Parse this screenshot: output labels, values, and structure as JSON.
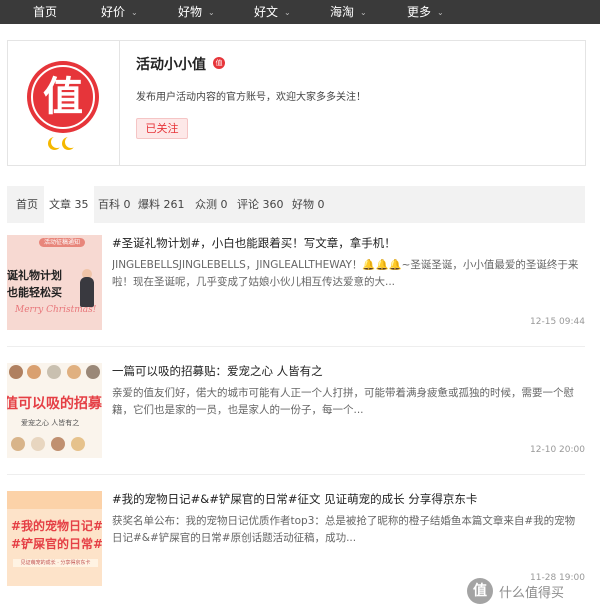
{
  "nav": {
    "items": [
      {
        "label": "首页",
        "dropdown": false
      },
      {
        "label": "好价",
        "dropdown": true
      },
      {
        "label": "好物",
        "dropdown": true
      },
      {
        "label": "好文",
        "dropdown": true
      },
      {
        "label": "海淘",
        "dropdown": true
      },
      {
        "label": "更多",
        "dropdown": true
      }
    ],
    "caret": "⌄"
  },
  "profile": {
    "avatar_glyph": "值",
    "name": "活动小小值",
    "badge": "值",
    "description": "发布用户活动内容的官方账号，欢迎大家多多关注！",
    "follow_label": "已关注"
  },
  "tabs": [
    {
      "label": "首页",
      "count": ""
    },
    {
      "label": "文章",
      "count": "35"
    },
    {
      "label": "百科",
      "count": "0"
    },
    {
      "label": "爆料",
      "count": "261"
    },
    {
      "label": "众测",
      "count": "0"
    },
    {
      "label": "评论",
      "count": "360"
    },
    {
      "label": "好物",
      "count": "0"
    }
  ],
  "active_tab": "文章",
  "articles": [
    {
      "title": "#圣诞礼物计划#，小白也能跟着买！写文章，拿手机！",
      "summary": "JINGLEBELLSJINGLEBELLS，JINGLEALLTHEWAY！🔔🔔🔔~圣诞圣诞，小小值最爱的圣诞终于来啦！现在圣诞呢，几乎变成了姑娘小伙儿相互传达爱意的大...",
      "time": "12-15 09:44",
      "thumb": {
        "tag": "活动征稿通知",
        "line1": "诞礼物计划",
        "line2": "也能轻松买",
        "merry": "Merry Christmas!"
      }
    },
    {
      "title": "一篇可以吸的招募贴：爱宠之心 人皆有之",
      "summary": "亲爱的值友们好，偌大的城市可能有人正一个人打拼，可能带着满身疲惫或孤独的时候，需要一个慰籍，它们也是家的一员，也是家人的一份子，每一个...",
      "time": "12-10 20:00",
      "thumb": {
        "big": "值可以吸的招募",
        "sub": "爱宠之心 人皆有之"
      }
    },
    {
      "title": "#我的宠物日记#&#铲屎官的日常#征文 见证萌宠的成长 分享得京东卡",
      "summary": "获奖名单公布：我的宠物日记优质作者top3：总是被抢了昵称的橙子结婚鱼本篇文章来自#我的宠物日记#&#铲屎官的日常#原创话题活动征稿，成功...",
      "time": "11-28 19:00",
      "thumb": {
        "line1": "#我的宠物日记#",
        "line2": "#铲屎官的日常#",
        "bottom": "见证萌宠的成长 · 分享得京东卡"
      }
    }
  ],
  "watermark": {
    "logo": "值",
    "text": "什么值得买"
  },
  "colors": {
    "nav_bg": "#3a3a3a",
    "accent": "#e6353a",
    "medal": "#f5b800"
  }
}
